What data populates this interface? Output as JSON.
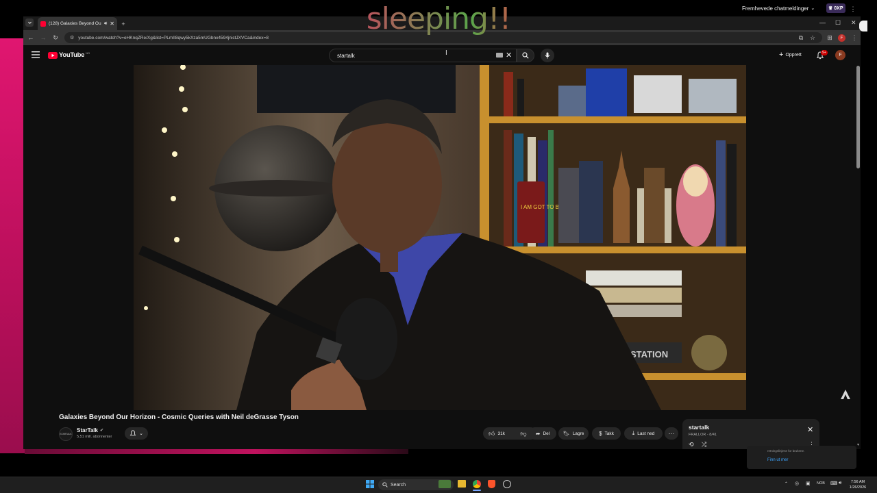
{
  "overlay": {
    "sleeping_text": "sleeping!!",
    "chat_button": "Fremhevede chatmeldinger",
    "xp_badge": "0XP"
  },
  "browser": {
    "tab_title": "(128) Galaxies Beyond Our",
    "url": "youtube.com/watch?v=eHKnqZRe/Xg&list=PLmII8qwy5kXza5mUGbnx4594jnictJXVCa&index=8",
    "profile_initial": "F"
  },
  "youtube": {
    "logo_text": "YouTube",
    "logo_country": "NO",
    "search_value": "startalk",
    "create_label": "Opprett",
    "notifications_count": "9+",
    "avatar_initial": "F",
    "video": {
      "title": "Galaxies Beyond Our Horizon - Cosmic Queries with Neil deGrasse Tyson",
      "channel_name": "StarTalk",
      "channel_avatar_text": "STARTALK",
      "subscribers": "5,51 mill. abonnenter",
      "likes": "31k",
      "share_label": "Del",
      "save_label": "Lagre",
      "thanks_label": "Takk",
      "download_label": "Last ned",
      "poster_text": "I AM GOT TO BE BOMBER",
      "shelf_label": "STATION"
    },
    "playlist": {
      "title": "startalk",
      "subtitle": "FRALLOR - 8/41"
    },
    "notice": {
      "text": "retningslinjene for brukene.",
      "link": "Finn ut mer"
    }
  },
  "taskbar": {
    "search_label": "Search",
    "language": "NOB",
    "time": "7:56 AM",
    "date": "1/26/2026"
  }
}
